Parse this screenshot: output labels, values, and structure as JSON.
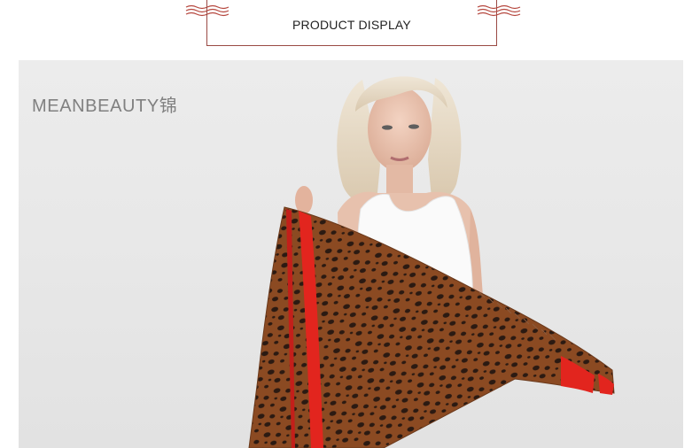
{
  "header": {
    "title": "PRODUCT DISPLAY"
  },
  "photo": {
    "brand_text": "MEANBEAUTY锦"
  },
  "colors": {
    "frame_line": "#9a4a44",
    "scarf_base": "#8b4a22",
    "scarf_stripe": "#e2251e",
    "brand_gray": "#808080"
  },
  "icons": [
    "wave-ornament-icon",
    "wave-ornament-icon"
  ]
}
